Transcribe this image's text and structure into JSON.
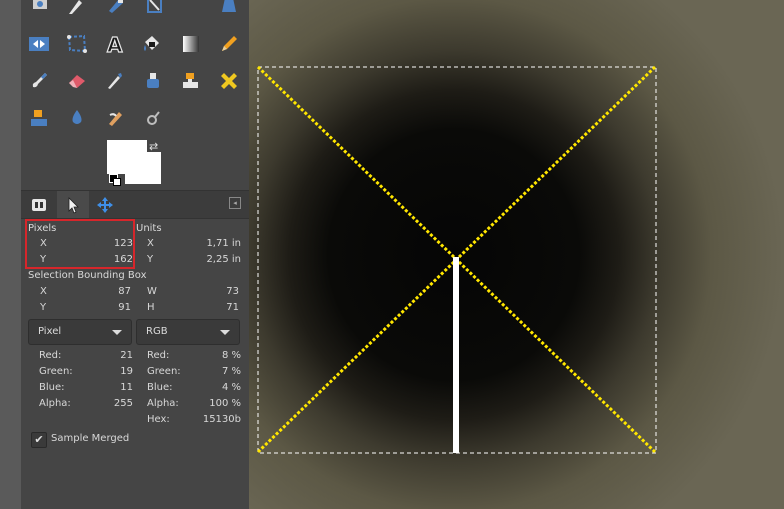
{
  "pointer": {
    "pixels_label": "Pixels",
    "units_label": "Units",
    "x_label": "X",
    "y_label": "Y",
    "x_pixels": "123",
    "y_pixels": "162",
    "x_units": "1,71 in",
    "y_units": "2,25 in"
  },
  "selection": {
    "title": "Selection Bounding Box",
    "x_label": "X",
    "y_label": "Y",
    "w_label": "W",
    "h_label": "H",
    "x": "87",
    "y": "91",
    "w": "73",
    "h": "71"
  },
  "pixel_combo": {
    "value": "Pixel"
  },
  "rgb_combo": {
    "value": "RGB"
  },
  "pixel_values": {
    "red_label": "Red:",
    "green_label": "Green:",
    "blue_label": "Blue:",
    "alpha_label": "Alpha:",
    "red": "21",
    "green": "19",
    "blue": "11",
    "alpha": "255"
  },
  "rgb_values": {
    "red_label": "Red:",
    "green_label": "Green:",
    "blue_label": "Blue:",
    "alpha_label": "Alpha:",
    "hex_label": "Hex:",
    "red": "8 %",
    "green": "7 %",
    "blue": "4 %",
    "alpha": "100 %",
    "hex": "15130b"
  },
  "sample_merged": {
    "label": "Sample Merged",
    "checked": true
  },
  "colors": {
    "selection_line": "#ffe600",
    "guide_line": "#ffffff",
    "highlight": "#d6262b",
    "panel_bg": "#454545"
  }
}
